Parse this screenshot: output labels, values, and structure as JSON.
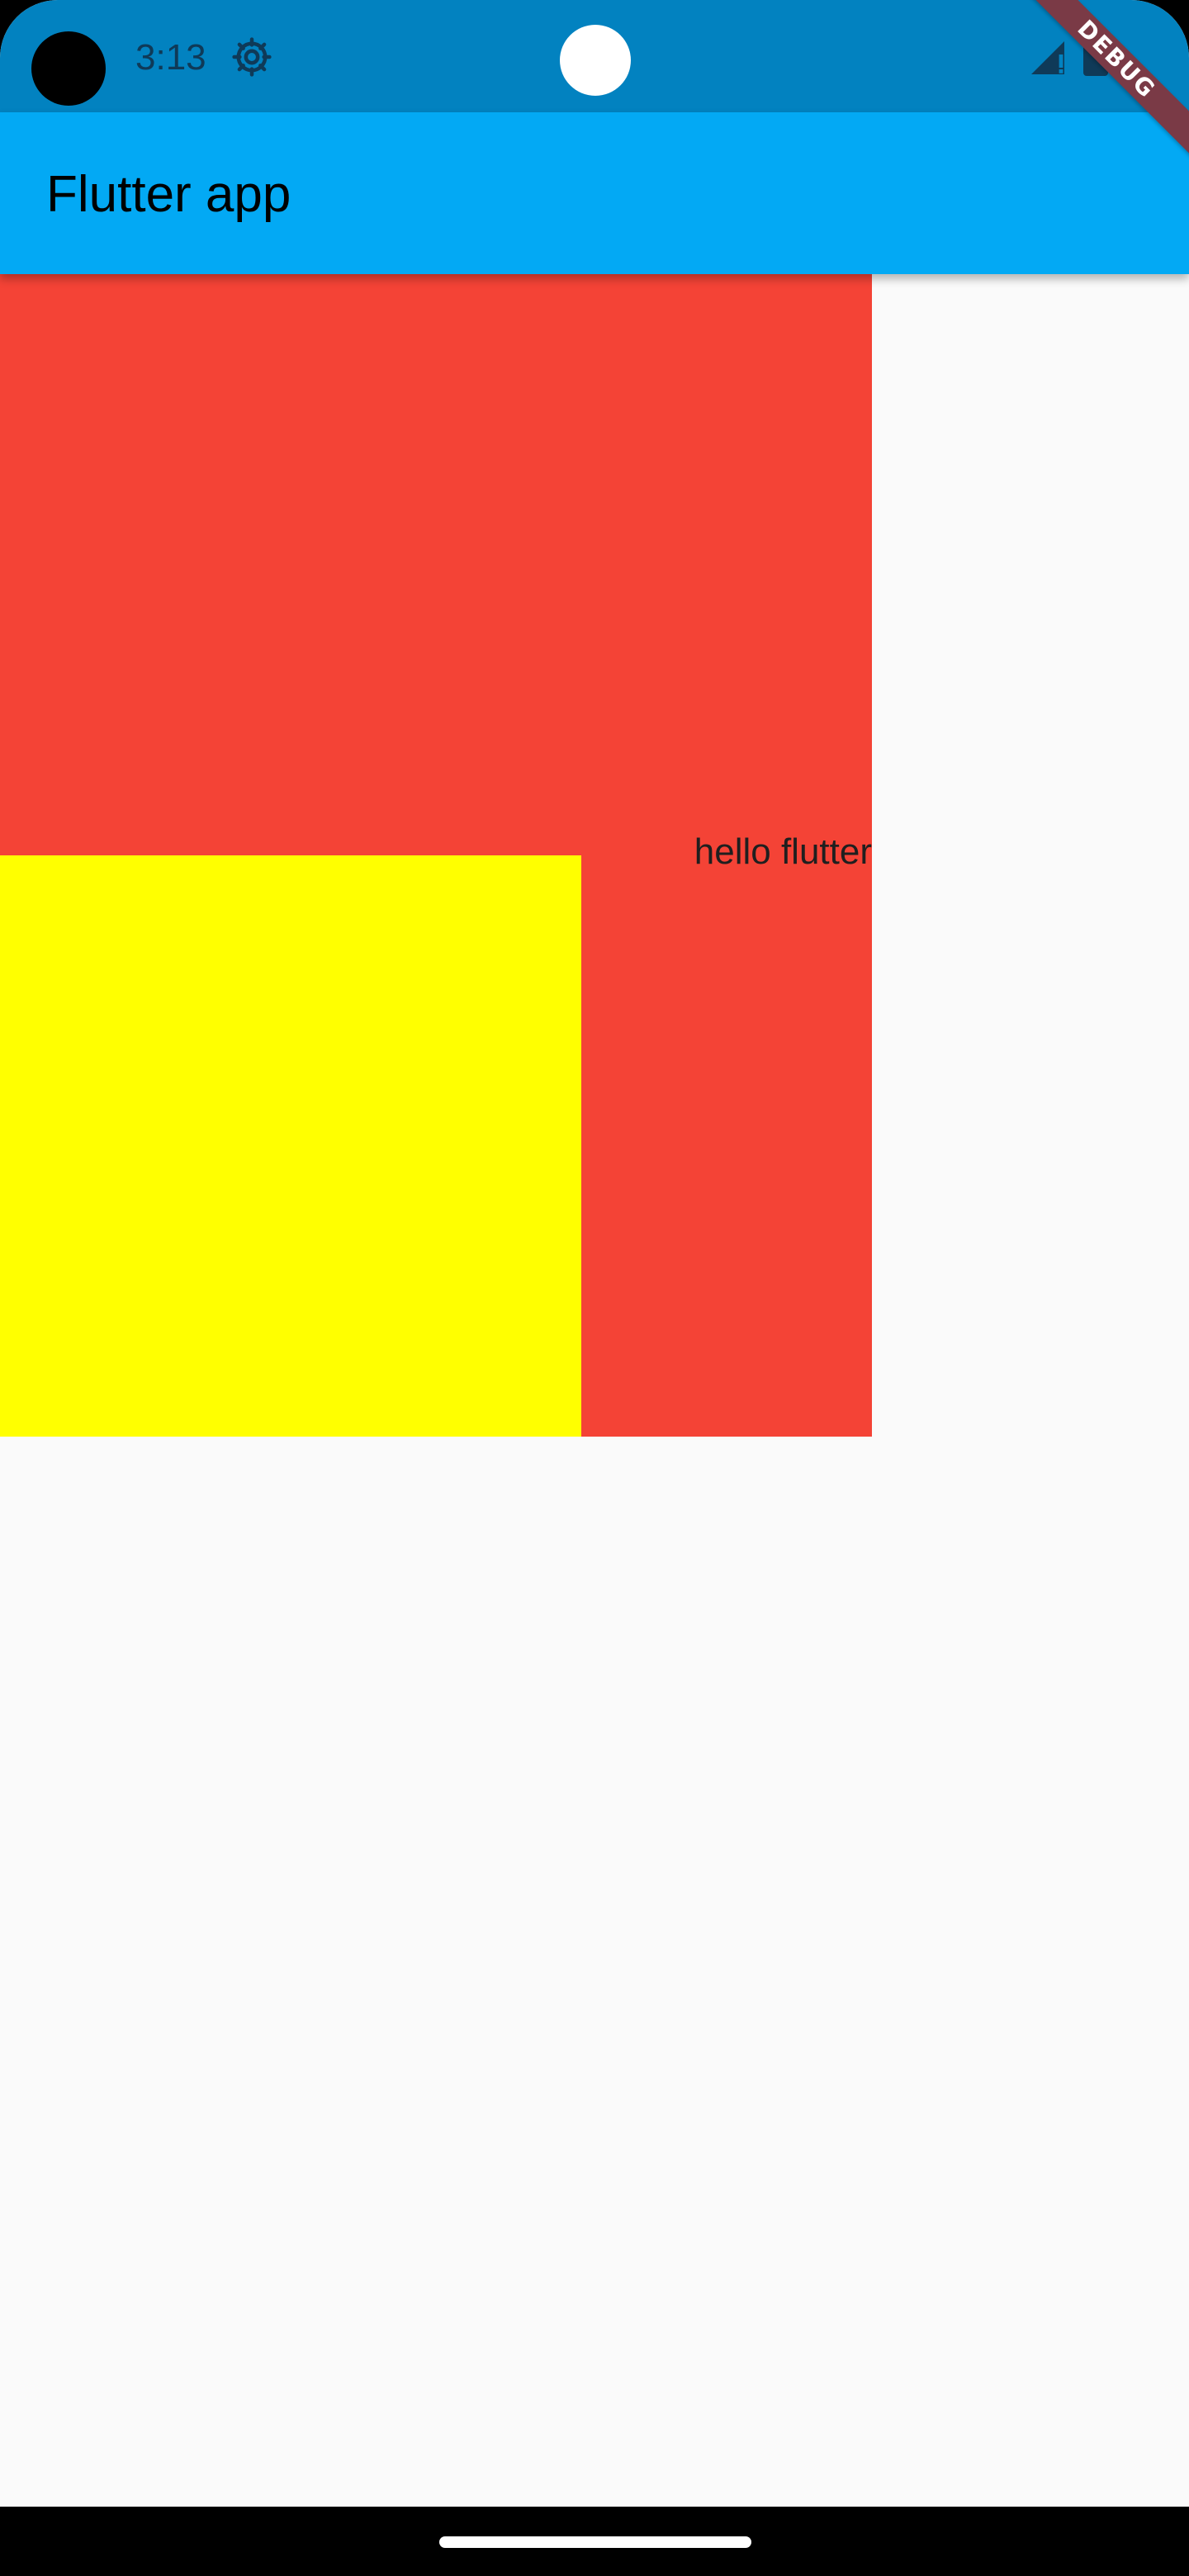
{
  "status_bar": {
    "time": "3:13",
    "icons": [
      "camera-cutout",
      "settings-icon",
      "signal-icon",
      "battery-icon"
    ],
    "background_color": "#0282c0"
  },
  "app_bar": {
    "title": "Flutter app",
    "background_color": "#03a9f4"
  },
  "debug_banner": {
    "label": "DEBUG",
    "color": "#7a3a46"
  },
  "content": {
    "outer_box_color": "#f44336",
    "inner_box_color": "#ffff00",
    "text": "hello flutter"
  },
  "navigation": {
    "gesture_handle": "home-handle"
  }
}
